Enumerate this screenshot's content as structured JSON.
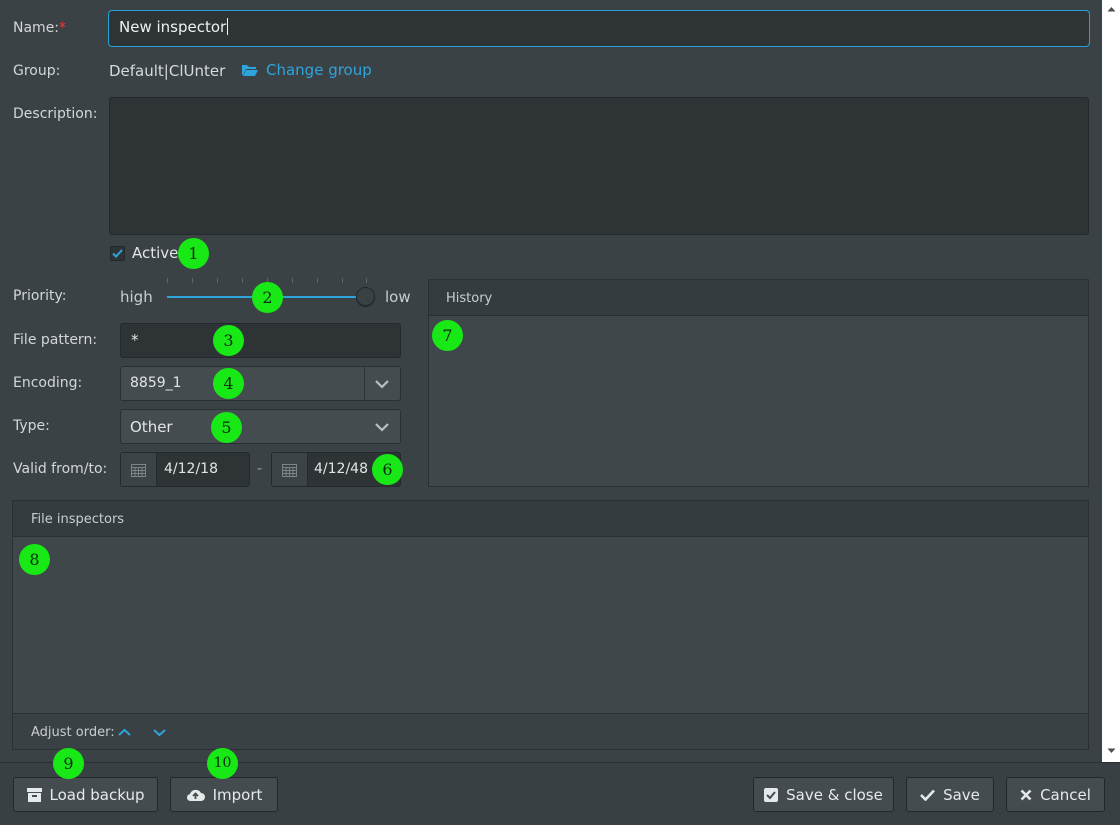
{
  "form": {
    "name_label": "Name:",
    "name_required": "*",
    "name_value": "New inspector",
    "group_label": "Group:",
    "group_value": "Default|ClUnter",
    "change_group": "Change group",
    "description_label": "Description:",
    "description_value": "",
    "active_label": "Active",
    "active_checked": true,
    "priority_label": "Priority:",
    "priority_high": "high",
    "priority_low": "low",
    "priority_level": 1.0,
    "file_pattern_label": "File pattern:",
    "file_pattern_value": "*",
    "encoding_label": "Encoding:",
    "encoding_value": "8859_1",
    "type_label": "Type:",
    "type_value": "Other",
    "valid_label": "Valid from/to:",
    "valid_from": "4/12/18",
    "valid_sep": "-",
    "valid_to": "4/12/48"
  },
  "history": {
    "title": "History"
  },
  "file_inspectors": {
    "title": "File inspectors",
    "adjust_order": "Adjust order:"
  },
  "footer": {
    "load_backup": "Load backup",
    "import": "Import",
    "save_close": "Save & close",
    "save": "Save",
    "cancel": "Cancel"
  },
  "markers": [
    "1",
    "2",
    "3",
    "4",
    "5",
    "6",
    "7",
    "8",
    "9",
    "10"
  ],
  "colors": {
    "accent": "#2ea4dd",
    "marker": "#17e816",
    "required": "#e0413b"
  }
}
